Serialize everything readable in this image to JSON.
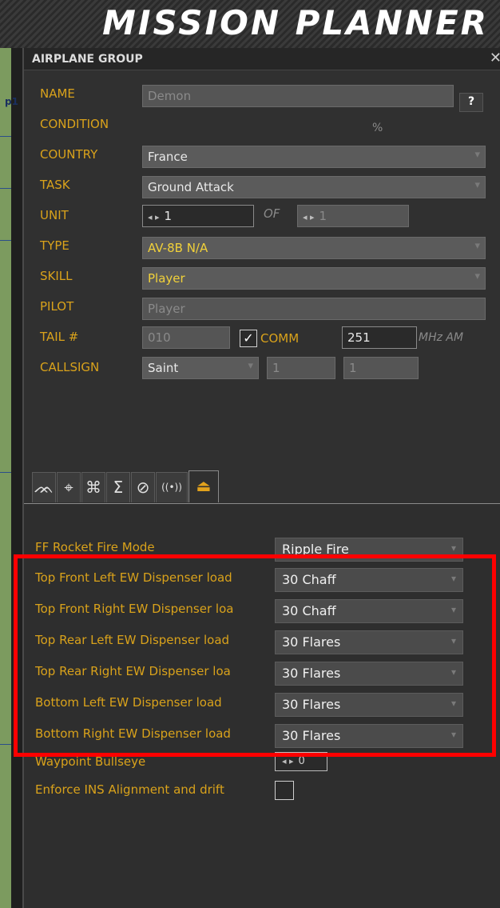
{
  "app": {
    "title": "MISSION PLANNER"
  },
  "map": {
    "label": "p1"
  },
  "panel": {
    "title": "AIRPLANE GROUP",
    "close_icon": "✕",
    "help_label": "?"
  },
  "fields": {
    "name_label": "NAME",
    "name_value": "Demon",
    "condition_label": "CONDITION",
    "condition_unit": "%",
    "country_label": "COUNTRY",
    "country_value": "France",
    "task_label": "TASK",
    "task_value": "Ground Attack",
    "unit_label": "UNIT",
    "unit_value": "1",
    "of_label": "OF",
    "unit_total": "1",
    "type_label": "TYPE",
    "type_value": "AV-8B N/A",
    "skill_label": "SKILL",
    "skill_value": "Player",
    "pilot_label": "PILOT",
    "pilot_value": "Player",
    "tail_label": "TAIL #",
    "tail_value": "010",
    "comm_checked_glyph": "✓",
    "comm_label": "COMM",
    "comm_value": "251",
    "mhz_label": "MHz AM",
    "callsign_label": "CALLSIGN",
    "callsign_value": "Saint",
    "callsign_num1": "1",
    "callsign_num2": "1"
  },
  "tabs": [
    {
      "icon": "route-icon",
      "glyph": "ᨏ"
    },
    {
      "icon": "target-icon",
      "glyph": "⌖"
    },
    {
      "icon": "loadout-icon",
      "glyph": "⌘"
    },
    {
      "icon": "summary-icon",
      "glyph": "Σ"
    },
    {
      "icon": "failures-icon",
      "glyph": "⊘"
    },
    {
      "icon": "radio-icon",
      "glyph": "((•))"
    },
    {
      "icon": "aircraft-settings-icon",
      "glyph": "⏏"
    }
  ],
  "properties": [
    {
      "label": "FF Rocket Fire Mode",
      "value": "Ripple Fire"
    },
    {
      "label": "Top Front Left EW Dispenser load",
      "value": "30 Chaff"
    },
    {
      "label": "Top Front Right EW Dispenser loa",
      "value": "30 Chaff"
    },
    {
      "label": "Top Rear Left EW Dispenser load",
      "value": "30 Flares"
    },
    {
      "label": "Top Rear Right EW Dispenser loa",
      "value": "30 Flares"
    },
    {
      "label": "Bottom Left EW Dispenser load",
      "value": "30 Flares"
    },
    {
      "label": "Bottom Right EW Dispenser load",
      "value": "30 Flares"
    },
    {
      "label": "Waypoint Bullseye",
      "value": "0"
    },
    {
      "label": "Enforce INS Alignment and drift",
      "value": ""
    }
  ],
  "colors": {
    "accent_label": "#d9a21b",
    "highlight_border": "#ff0000",
    "yellow_value": "#f1d13a"
  }
}
